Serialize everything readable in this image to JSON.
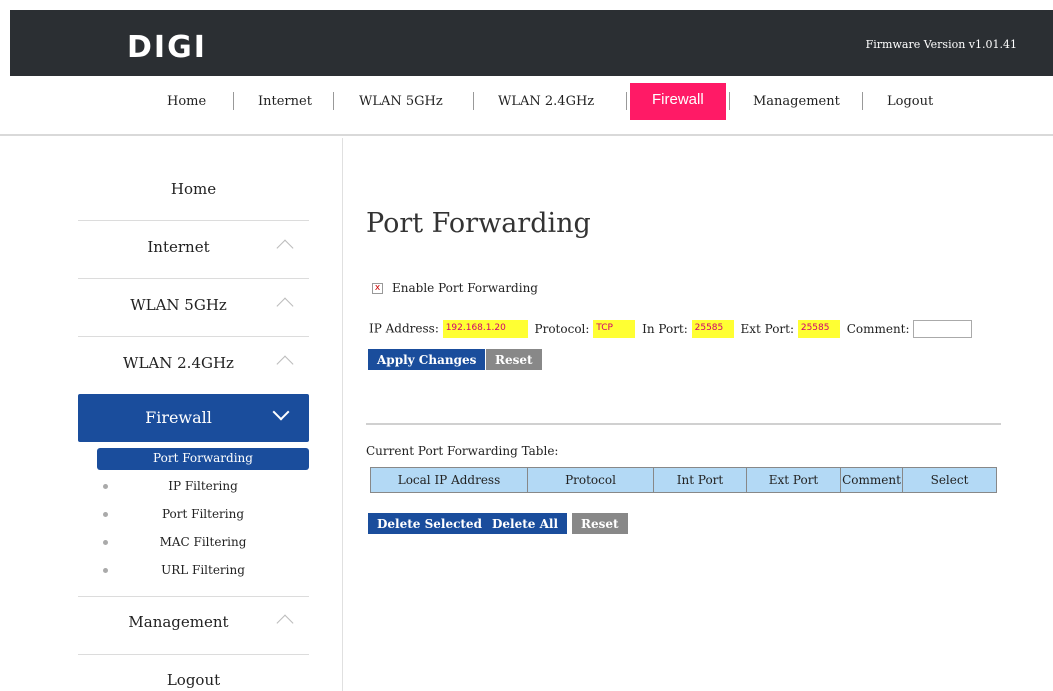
{
  "header": {
    "logo": "DIGI",
    "firmware": "Firmware Version v1.01.41"
  },
  "topnav": {
    "home": "Home",
    "internet": "Internet",
    "wlan5": "WLAN 5GHz",
    "wlan24": "WLAN 2.4GHz",
    "firewall": "Firewall",
    "management": "Management",
    "logout": "Logout"
  },
  "sidebar": {
    "home": "Home",
    "internet": "Internet",
    "wlan5": "WLAN 5GHz",
    "wlan24": "WLAN 2.4GHz",
    "firewall": "Firewall",
    "management": "Management",
    "logout": "Logout",
    "sub": {
      "port_forwarding": "Port Forwarding",
      "ip_filtering": "IP Filtering",
      "port_filtering": "Port Filtering",
      "mac_filtering": "MAC Filtering",
      "url_filtering": "URL Filtering"
    }
  },
  "main": {
    "title": "Port Forwarding",
    "enable_label": "Enable Port Forwarding",
    "checkbox_mark": "x",
    "fields": {
      "ip_label": "IP Address:",
      "ip_value": "192.168.1.20",
      "protocol_label": "Protocol:",
      "protocol_value": "TCP",
      "inport_label": "In Port:",
      "inport_value": "25585",
      "extport_label": "Ext Port:",
      "extport_value": "25585",
      "comment_label": "Comment:",
      "comment_value": ""
    },
    "apply_label": "Apply Changes",
    "reset_label": "Reset",
    "table_title": "Current Port Forwarding Table:",
    "table_headers": [
      "Local IP Address",
      "Protocol",
      "Int Port",
      "Ext Port",
      "Comment",
      "Select"
    ],
    "delete_selected_label": "Delete Selected",
    "delete_all_label": "Delete All",
    "table_reset_label": "Reset"
  },
  "colors": {
    "header_bg": "#2b2f33",
    "accent_pink": "#ff1a66",
    "accent_blue": "#1a4d9c",
    "field_highlight": "#ffff33",
    "table_header_bg": "#b3d9f5"
  }
}
